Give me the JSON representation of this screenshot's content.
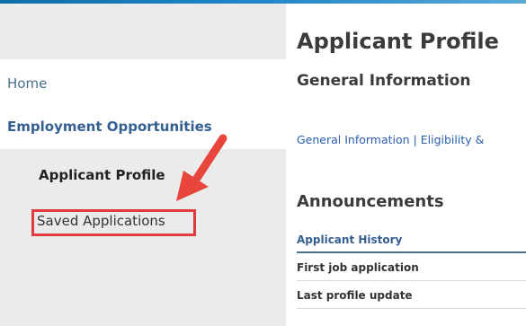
{
  "sidebar": {
    "home_label": "Home",
    "employment_label": "Employment Opportunities",
    "applicant_profile_label": "Applicant Profile",
    "saved_applications_label": "Saved Applications"
  },
  "main": {
    "title": "Applicant Profile",
    "section_heading": "General Information",
    "subnav": "General Information | Eligibility &",
    "announcements_heading": "Announcements",
    "table": {
      "header": "Applicant History",
      "rows": [
        "First job application",
        "Last profile update"
      ]
    }
  },
  "colors": {
    "highlight_box": "#e0393e",
    "arrow": "#e8453c",
    "link": "#2a5fb0",
    "sidebar_bg": "#ebebeb"
  },
  "icons": {
    "annotation": "red-arrow-icon"
  }
}
